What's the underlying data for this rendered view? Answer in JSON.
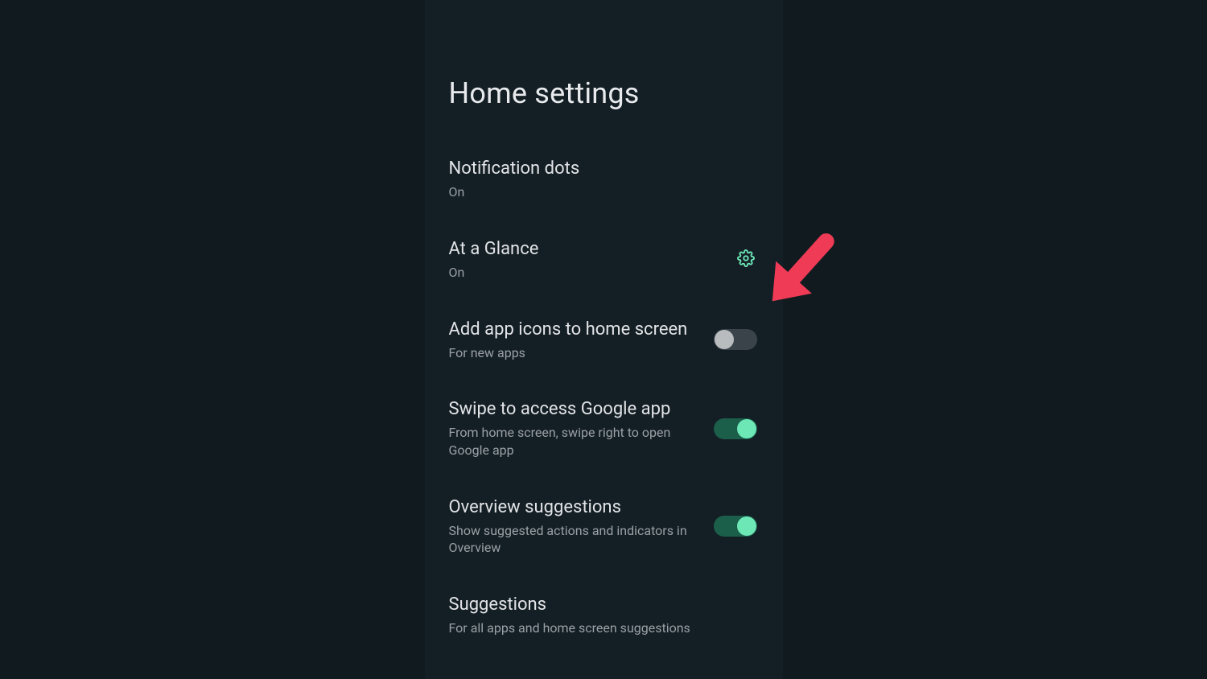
{
  "page_title": "Home settings",
  "colors": {
    "accent": "#6ee7b7",
    "accent_track": "#1b5e4a",
    "off_track": "#3a4349",
    "off_thumb": "#b8bcbf",
    "arrow": "#ef3b55"
  },
  "settings": [
    {
      "id": "notification-dots",
      "title": "Notification dots",
      "subtitle": "On",
      "control": "none"
    },
    {
      "id": "at-a-glance",
      "title": "At a Glance",
      "subtitle": "On",
      "control": "gear"
    },
    {
      "id": "add-app-icons",
      "title": "Add app icons to home screen",
      "subtitle": "For new apps",
      "control": "toggle",
      "toggle_on": false
    },
    {
      "id": "swipe-google",
      "title": "Swipe to access Google app",
      "subtitle": "From home screen, swipe right to open Google app",
      "control": "toggle",
      "toggle_on": true
    },
    {
      "id": "overview-suggestions",
      "title": "Overview suggestions",
      "subtitle": "Show suggested actions and indicators in Overview",
      "control": "toggle",
      "toggle_on": true
    },
    {
      "id": "suggestions",
      "title": "Suggestions",
      "subtitle": "For all apps and home screen suggestions",
      "control": "none"
    }
  ],
  "annotation": {
    "type": "arrow",
    "target": "add-app-icons-toggle"
  }
}
